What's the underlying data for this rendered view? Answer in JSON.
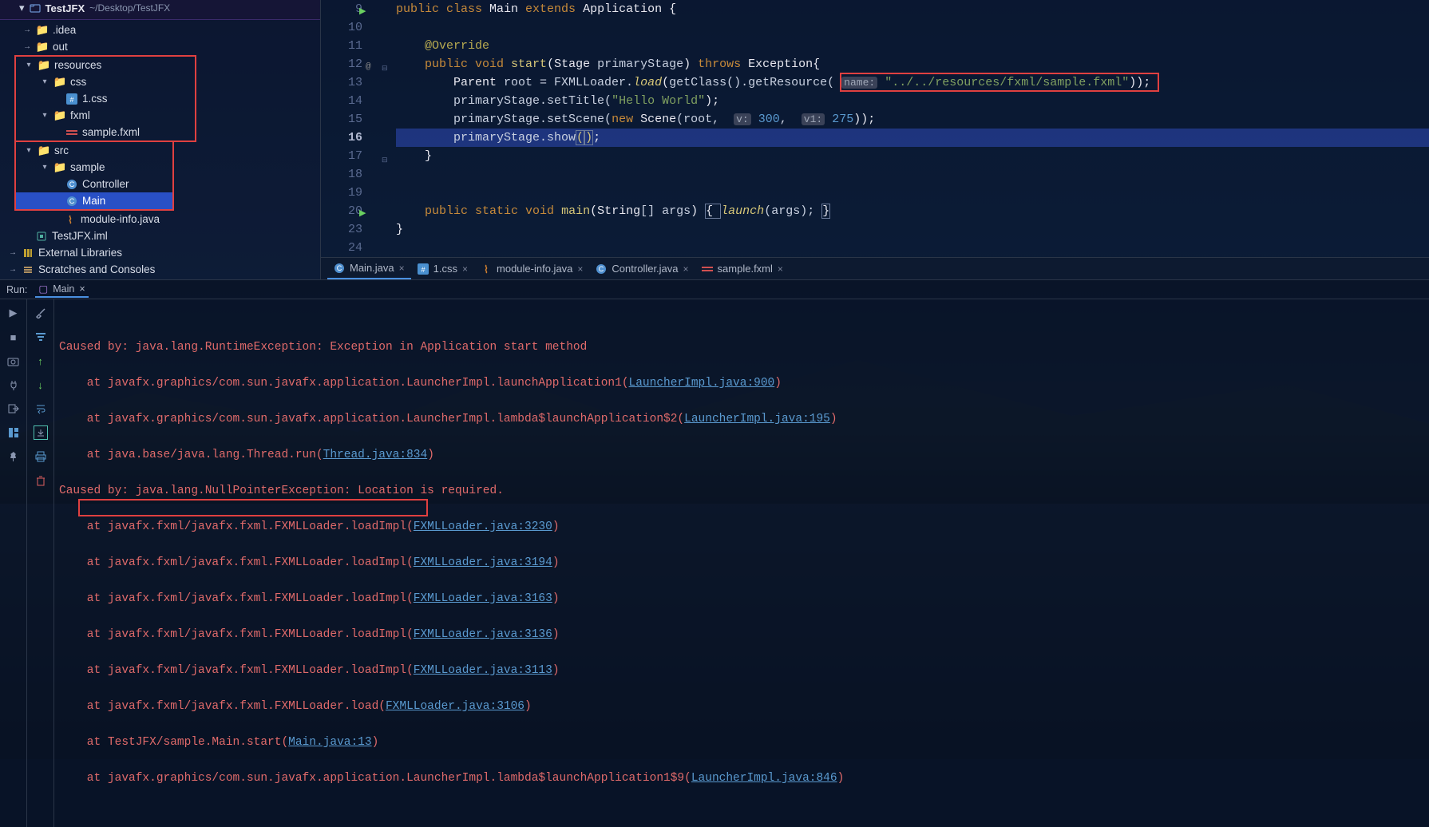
{
  "project": {
    "name": "TestJFX",
    "path": "~/Desktop/TestJFX"
  },
  "tree": {
    "idea": ".idea",
    "out": "out",
    "resources": "resources",
    "css": "css",
    "css_file": "1.css",
    "fxml": "fxml",
    "fxml_file": "sample.fxml",
    "src": "src",
    "sample": "sample",
    "controller": "Controller",
    "main": "Main",
    "module_info": "module-info.java",
    "iml": "TestJFX.iml",
    "ext_libs": "External Libraries",
    "scratches": "Scratches and Consoles"
  },
  "line_numbers": [
    "9",
    "10",
    "11",
    "12",
    "13",
    "14",
    "15",
    "16",
    "17",
    "18",
    "19",
    "20",
    "23",
    "24"
  ],
  "code": {
    "l9": {
      "public": "public ",
      "class": "class ",
      "main": "Main ",
      "extends": "extends ",
      "app": "Application ",
      "ob": "{"
    },
    "l11": "@Override",
    "l12": {
      "public": "public ",
      "void": "void ",
      "start": "start",
      "op": "(",
      "stage": "Stage ",
      "ps": "primaryStage",
      "cp": ") ",
      "throws": "throws ",
      "exc": "Exception",
      "ob": "{"
    },
    "l13": {
      "parent": "Parent ",
      "root": "root = ",
      "fx": "FXMLLoader.",
      "load": "load",
      "op": "(",
      "gc": "getClass().getResource(",
      "hint": "name:",
      "sp": " ",
      "str": "\"../../resources/fxml/sample.fxml\"",
      "cp": "));"
    },
    "l14": {
      "ps": "primaryStage.setTitle(",
      "str": "\"Hello World\"",
      "cp": ");"
    },
    "l15": {
      "ps": "primaryStage.setScene(",
      "new": "new ",
      "scene": "Scene",
      "op": "(root, ",
      "h1": "v:",
      "sp1": " ",
      "n1": "300",
      "c": ", ",
      "h2": "v1:",
      "sp2": " ",
      "n2": "275",
      "cp": "));"
    },
    "l16": {
      "ps": "primaryStage.show",
      "op": "(",
      "cp": ")",
      "sc": ";"
    },
    "l17": "}",
    "l20": {
      "public": "public ",
      "static": "static ",
      "void": "void ",
      "main": "main",
      "op": "(",
      "str": "String",
      "arr": "[] ",
      "args": "args",
      "cp": ") ",
      "ob": "{ ",
      "launch": "launch",
      "op2": "(args); ",
      "cb": "}"
    },
    "l23": "}"
  },
  "tabs": [
    {
      "name": "Main.java",
      "icon": "class-icon"
    },
    {
      "name": "1.css",
      "icon": "css-icon"
    },
    {
      "name": "module-info.java",
      "icon": "java-icon"
    },
    {
      "name": "Controller.java",
      "icon": "class-icon"
    },
    {
      "name": "sample.fxml",
      "icon": "fxml-icon"
    }
  ],
  "run": {
    "label": "Run:",
    "config": "Main"
  },
  "console": {
    "l1": "Caused by: java.lang.RuntimeException: Exception in Application start method",
    "l2a": "    at javafx.graphics/com.sun.javafx.application.LauncherImpl.launchApplication1(",
    "l2l": "LauncherImpl.java:900",
    "l3a": "    at javafx.graphics/com.sun.javafx.application.LauncherImpl.lambda$launchApplication$2(",
    "l3l": "LauncherImpl.java:195",
    "l4a": "    at java.base/java.lang.Thread.run(",
    "l4l": "Thread.java:834",
    "l5": "Caused by: java.lang.NullPointerException: Location is required.",
    "l6a": "    at javafx.fxml/javafx.fxml.FXMLLoader.loadImpl(",
    "l6l": "FXMLLoader.java:3230",
    "l7l": "FXMLLoader.java:3194",
    "l8l": "FXMLLoader.java:3163",
    "l9l": "FXMLLoader.java:3136",
    "l10l": "FXMLLoader.java:3113",
    "l11a": "    at javafx.fxml/javafx.fxml.FXMLLoader.load(",
    "l11l": "FXMLLoader.java:3106",
    "l12a": "    at TestJFX/sample.Main.start(",
    "l12l": "Main.java:13",
    "l13a": "    at javafx.graphics/com.sun.javafx.application.LauncherImpl.lambda$launchApplication1$9(",
    "l13l": "LauncherImpl.java:846",
    "close": ")"
  }
}
